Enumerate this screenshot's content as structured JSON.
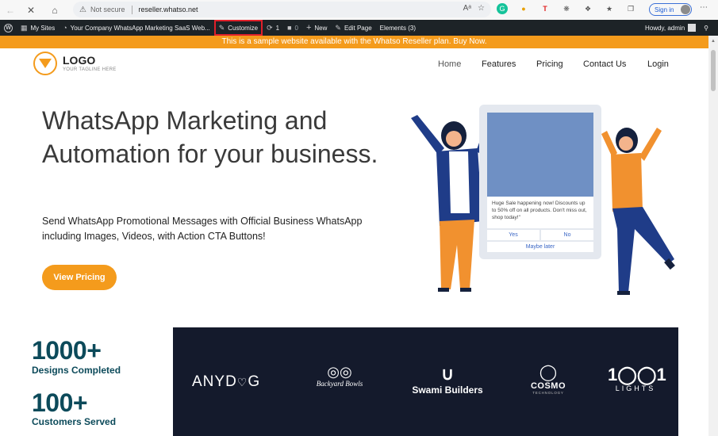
{
  "browser": {
    "security_label": "Not secure",
    "url": "reseller.whatso.net",
    "sign_in": "Sign in"
  },
  "adminbar": {
    "my_sites": "My Sites",
    "site_name": "Your Company WhatsApp Marketing SaaS Web...",
    "customize": "Customize",
    "updates_count": "1",
    "comments_count": "0",
    "new": "New",
    "edit_page": "Edit Page",
    "elements": "Elements (3)",
    "howdy": "Howdy, admin"
  },
  "notice": "This is a sample website available with the Whatso Reseller plan. Buy Now.",
  "header": {
    "logo": "LOGO",
    "tagline": "YOUR TAGLINE HERE",
    "menu": [
      "Home",
      "Features",
      "Pricing",
      "Contact Us",
      "Login"
    ]
  },
  "hero": {
    "title": "WhatsApp Marketing and Automation for your business.",
    "subtitle": "Send WhatsApp Promotional Messages with Official Business WhatsApp including Images, Videos, with Action CTA Buttons!",
    "cta": "View Pricing"
  },
  "illustration": {
    "message": "Huge Sale happening now! Discounts up to 50% off on all products. Don't miss out, shop today!\"",
    "yes": "Yes",
    "no": "No",
    "maybe": "Maybe later"
  },
  "stats": [
    {
      "number": "1000+",
      "label": "Designs Completed"
    },
    {
      "number": "100+",
      "label": "Customers Served"
    }
  ],
  "brands": {
    "anydog": "ANYD",
    "anydog_tail": "G",
    "backyard": "Backyard Bowls",
    "swami": "Swami Builders",
    "cosmo": "COSMO",
    "cosmo_sub": "TECHNOLOGY",
    "lights_top": "1",
    "lights_mid": "1",
    "lights": "LIGHTS"
  },
  "colors": {
    "accent": "#f49b1c",
    "adminbar": "#1d2327",
    "stat_text": "#0c4a5a",
    "brand_panel": "#141a2c"
  }
}
